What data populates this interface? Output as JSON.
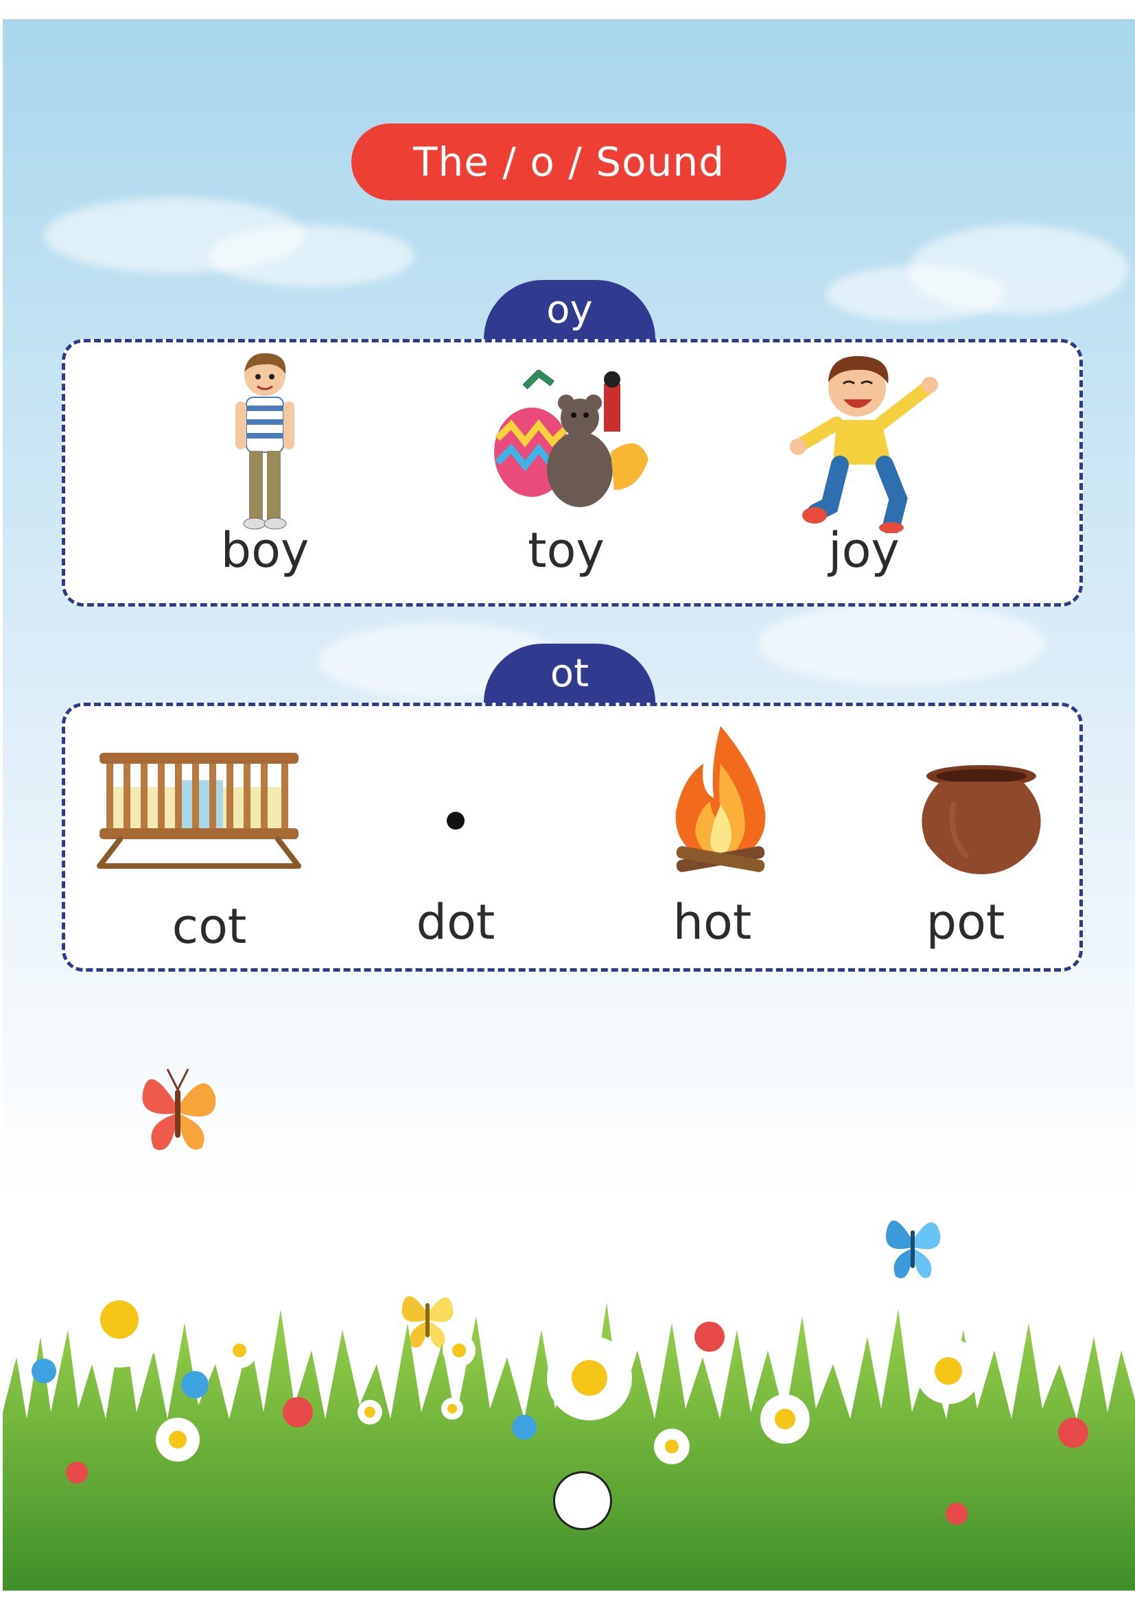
{
  "header": {
    "title": "The / o / Sound"
  },
  "groups": [
    {
      "tab_label": "oy",
      "items": [
        {
          "word": "boy",
          "icon": "boy-icon"
        },
        {
          "word": "toy",
          "icon": "toys-icon"
        },
        {
          "word": "joy",
          "icon": "joyful-boy-icon"
        }
      ]
    },
    {
      "tab_label": "ot",
      "items": [
        {
          "word": "cot",
          "icon": "cot-icon"
        },
        {
          "word": "dot",
          "icon": "dot-icon"
        },
        {
          "word": "hot",
          "icon": "fire-icon"
        },
        {
          "word": "pot",
          "icon": "pot-icon"
        }
      ]
    }
  ],
  "colors": {
    "title_pill": "#ee3f35",
    "tab": "#303a8f",
    "box_border": "#2e3a8c",
    "text": "#2c2c2c"
  }
}
